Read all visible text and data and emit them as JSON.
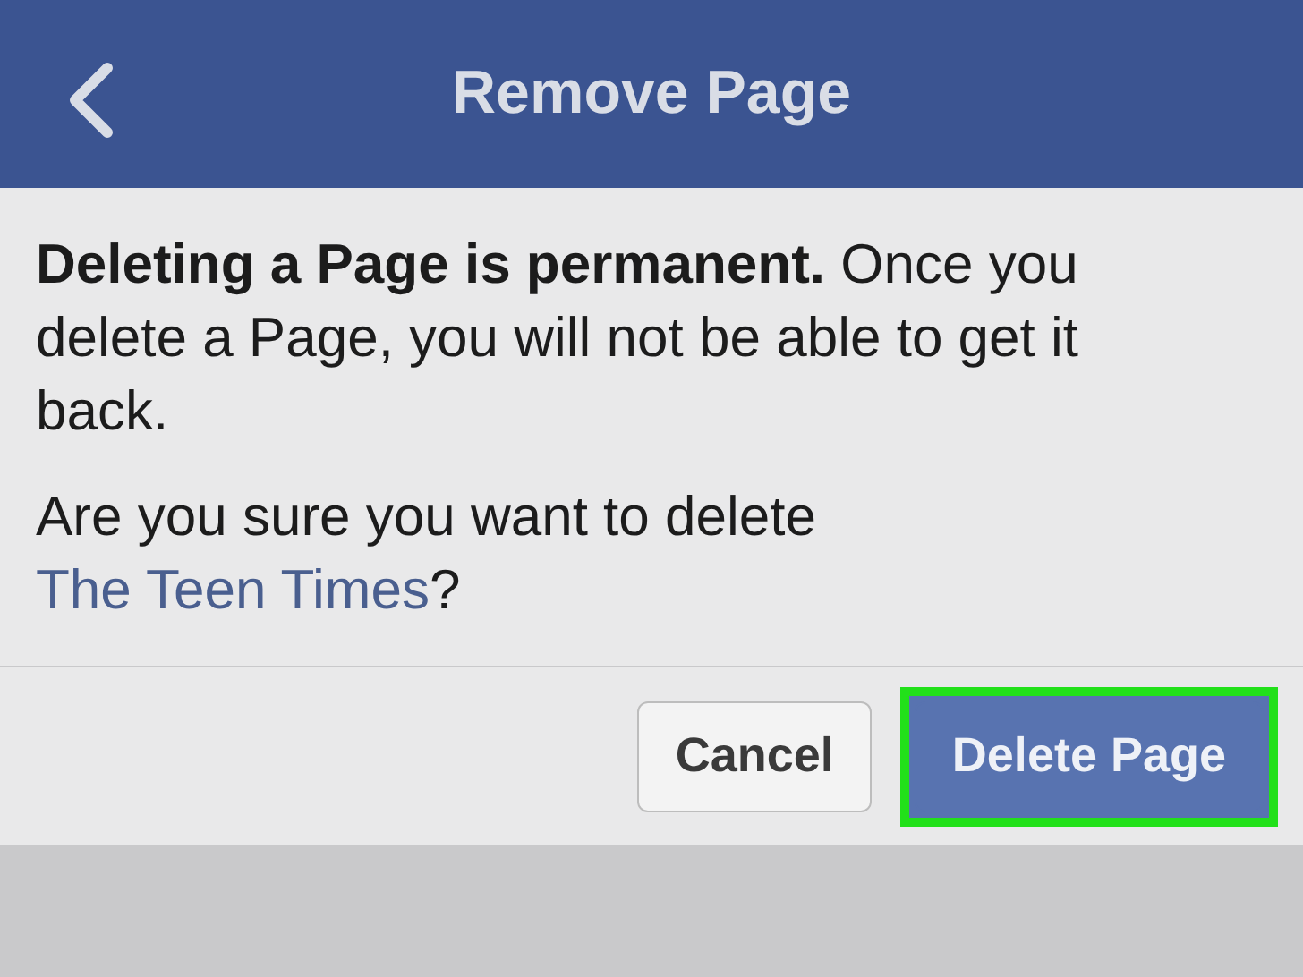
{
  "header": {
    "title": "Remove Page"
  },
  "message": {
    "text": "**Deleting a Page is permanent.** Once you delete a Page, you will not be able to get it back."
  },
  "question": {
    "text": "Are you sure you want to delete ",
    "link": "The Teen Times",
    "suffix": "?"
  },
  "buttons": [
    {
      "label": "Cancel",
      "kind": "secondary",
      "highlighted": false
    },
    {
      "label": "Delete Page",
      "kind": "primary",
      "highlighted": true
    }
  ]
}
